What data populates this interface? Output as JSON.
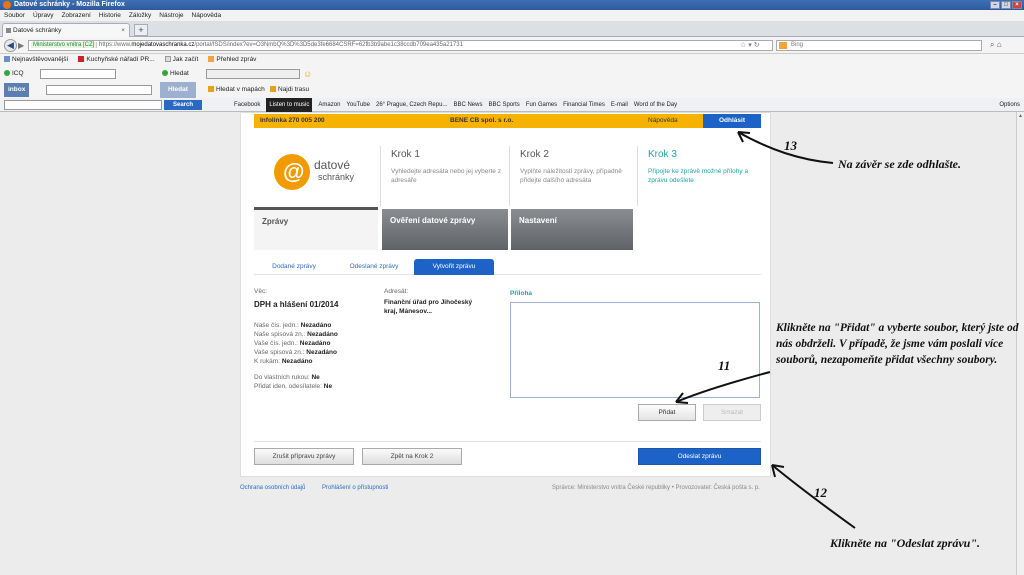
{
  "window": {
    "title": "Datové schránky - Mozilla Firefox"
  },
  "menu": [
    "Soubor",
    "Úpravy",
    "Zobrazení",
    "Historie",
    "Záložky",
    "Nástroje",
    "Nápověda"
  ],
  "tab": {
    "label": "Datové schránky",
    "new_tab": "+"
  },
  "nav": {
    "identity": "Ministerstvo vnitra [CZ]",
    "url_prefix": "https://www.",
    "url_domain": "mojedatovaschranka.cz",
    "url_rest": "/portal/ISDS/index?ev=O3NmbQ%3D%3D5de3fe6684CSRF=62fb3b9abe1c38ccdb709ea435a21731",
    "search_placeholder": "Bing"
  },
  "bookmarks": [
    "Nejnavštěvovanější",
    "Kuchyňské nářadí PR...",
    "Jak začít",
    "Přehled zpráv"
  ],
  "toolbar2": {
    "icq": "ICQ",
    "hledat": "Hledat"
  },
  "toolbar3": {
    "inbox": "inbox",
    "hledat": "Hledat",
    "map": "Hledat v mapách",
    "route": "Najdi trasu"
  },
  "toolbar4": {
    "search_btn": "Search",
    "items": [
      "Facebook",
      "Listen to music",
      "Amazon",
      "YouTube",
      "26° Prague, Czech Repu...",
      "BBC News",
      "BBC Sports",
      "Fun Games",
      "Financial Times",
      "E-mail",
      "Word of the Day"
    ],
    "options": "Options"
  },
  "portal": {
    "infolinka": "Infolinka 270 005 200",
    "firm": "BENE CB spol. s r.o.",
    "napoveda": "Nápověda",
    "odhlasit": "Odhlásit",
    "logo_line1": "datové",
    "logo_line2": "schránky",
    "steps": [
      {
        "title": "Krok 1",
        "text": "Vyhledejte adresáta nebo jej vyberte z adresáře"
      },
      {
        "title": "Krok 2",
        "text": "Vyplňte náležitosti zprávy, případně přidejte dalšího adresáta"
      },
      {
        "title": "Krok 3",
        "text": "Připojte ke zprávě možné přílohy a zprávu odešlete"
      }
    ],
    "nav_tabs": [
      "Zprávy",
      "Ověření datové zprávy",
      "Nastavení"
    ],
    "sub_tabs": [
      "Dodané zprávy",
      "Odeslané zprávy",
      "Vytvořit zprávu"
    ],
    "vec_label": "Věc:",
    "vec_value": "DPH a hlášení 01/2014",
    "fields": [
      {
        "label": "Naše čís. jedn.:",
        "value": "Nezadáno"
      },
      {
        "label": "Naše spisová zn.:",
        "value": "Nezadáno"
      },
      {
        "label": "Vaše čís. jedn.:",
        "value": "Nezadáno"
      },
      {
        "label": "Vaše spisová zn.:",
        "value": "Nezadáno"
      },
      {
        "label": "K rukám:",
        "value": "Nezadáno"
      }
    ],
    "fields2": [
      {
        "label": "Do vlastních rukou:",
        "value": "Ne"
      },
      {
        "label": "Přidat iden. odesílatele:",
        "value": "Ne"
      }
    ],
    "adresat_label": "Adresát:",
    "adresat_value": "Finanční úřad pro Jihočeský kraj, Mánesov...",
    "priloha": "Příloha",
    "pridat": "Přidat",
    "smazat": "Smazat",
    "zrusit": "Zrušit přípravu zprávy",
    "zpet": "Zpět na Krok 2",
    "odeslat": "Odeslat zprávu",
    "footer_1": "Ochrana osobních údajů",
    "footer_2": "Prohlášení o přístupnosti",
    "footer_3": "Správce: Ministerstvo vnitra České republiky • Provozovatel: Česká pošta s. p."
  },
  "annotations": {
    "n13": "13",
    "t13": "Na závěr se zde odhlašte.",
    "n11": "11",
    "t11": "Klikněte na \"Přidat\" a vyberte soubor, který jste od nás obdrželi. V případě, že jsme vám poslali více souborů, nezapomeňte přidat všechny soubory.",
    "n12": "12",
    "t12": "Klikněte na \"Odeslat zprávu\"."
  }
}
